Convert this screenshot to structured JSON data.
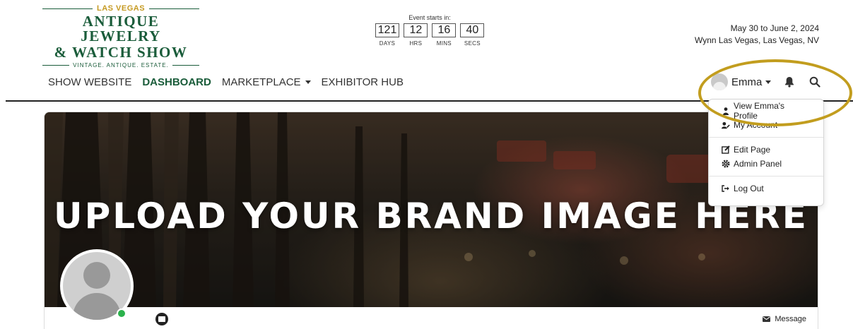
{
  "logo": {
    "top": "LAS VEGAS",
    "line1": "ANTIQUE JEWELRY",
    "line2": "& WATCH SHOW",
    "tagline": "VINTAGE. ANTIQUE. ESTATE."
  },
  "countdown": {
    "label": "Event starts in:",
    "units": [
      {
        "value": "121",
        "caption": "DAYS"
      },
      {
        "value": "12",
        "caption": "HRS"
      },
      {
        "value": "16",
        "caption": "MINS"
      },
      {
        "value": "40",
        "caption": "SECS"
      }
    ]
  },
  "event": {
    "dates": "May 30 to June 2, 2024",
    "venue": "Wynn Las Vegas, Las Vegas, NV"
  },
  "nav": {
    "items": [
      {
        "label": "SHOW WEBSITE"
      },
      {
        "label": "DASHBOARD"
      },
      {
        "label": "MARKETPLACE"
      },
      {
        "label": "EXHIBITOR HUB"
      }
    ]
  },
  "user": {
    "name": "Emma"
  },
  "dropdown": {
    "items": [
      {
        "label": "View Emma's Profile",
        "icon": "user-icon"
      },
      {
        "label": "My Account",
        "icon": "user-edit-icon"
      },
      {
        "label": "Edit Page",
        "icon": "edit-icon"
      },
      {
        "label": "Admin Panel",
        "icon": "cog-icon"
      },
      {
        "label": "Log Out",
        "icon": "logout-icon"
      }
    ]
  },
  "banner": {
    "text": "UPLOAD YOUR BRAND IMAGE HERE"
  },
  "profile": {
    "message_label": "Message"
  },
  "colors": {
    "brand_green": "#1a5c3a",
    "gold": "#c29d1e",
    "online": "#2bb24c"
  }
}
